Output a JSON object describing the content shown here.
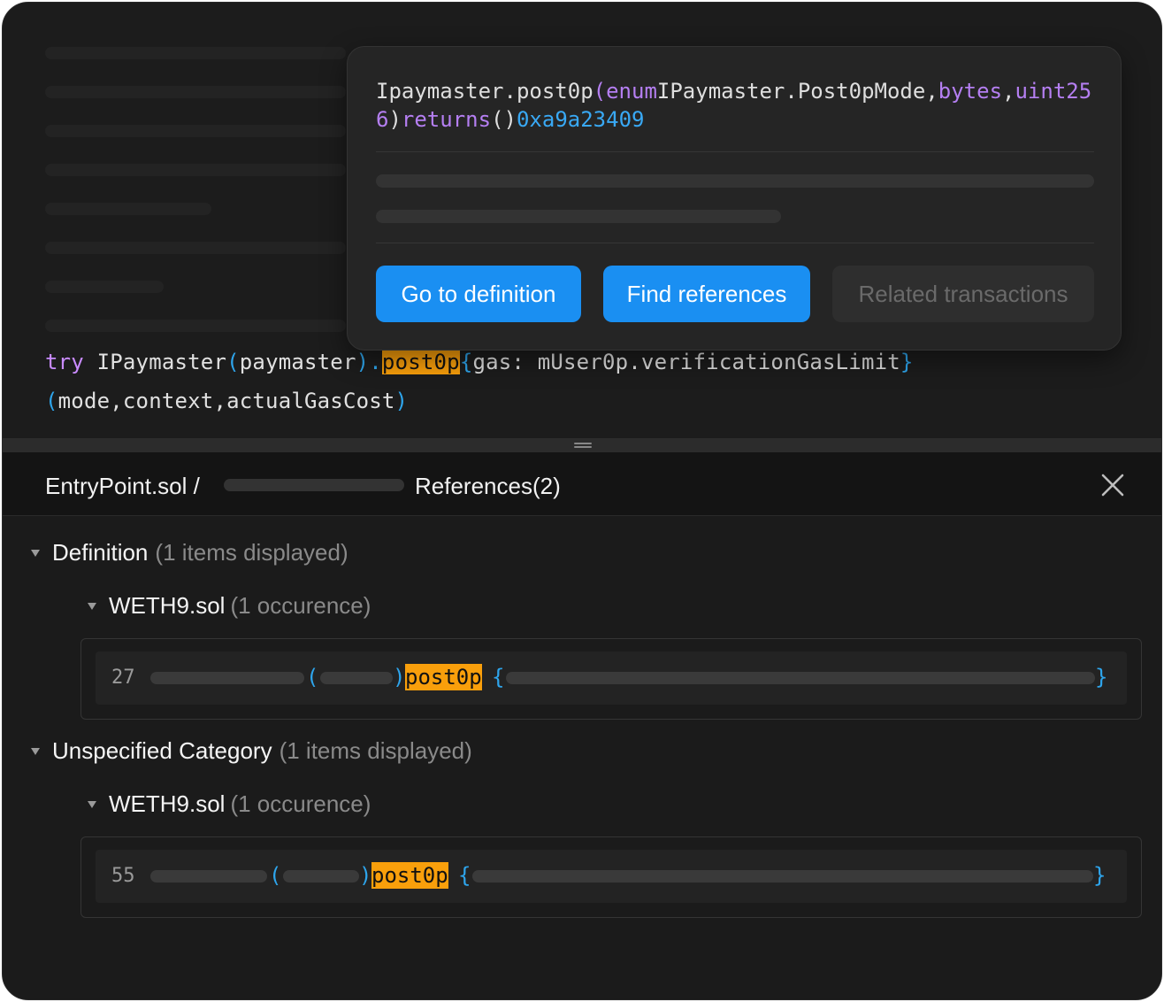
{
  "editor": {
    "code_line_1": {
      "kw_try": "try",
      "ident": " IPaymaster",
      "paren_open": "(",
      "arg": "paymaster",
      "paren_close": ")",
      "dot": ".",
      "highlight": "post0p",
      "brace_open": "{",
      "gas_text": "gas: mUser0p.verificationGasLimit",
      "brace_close": "}"
    },
    "code_line_2": {
      "paren_open": "(",
      "args": "mode,context,actualGasCost",
      "paren_close": ")"
    }
  },
  "popover": {
    "signature": {
      "name": "Ipaymaster.post0p",
      "paren_open": "(",
      "type1": "enum",
      "type1_name": "IPaymaster.Post0pMode",
      "comma1": ",",
      "type2": "bytes",
      "comma2": ",",
      "type3": "uint256",
      "paren_close": ")",
      "returns_kw": "returns",
      "returns_parens": "()",
      "selector": "0xa9a23409"
    },
    "buttons": {
      "go_to_definition": "Go to definition",
      "find_references": "Find references",
      "related_transactions": "Related transactions"
    }
  },
  "panel": {
    "breadcrumb_file": "EntryPoint.sol /",
    "breadcrumb_title": "References(2)",
    "groups": [
      {
        "title": "Definition",
        "count": "(1 items displayed)",
        "file": "WETH9.sol",
        "file_count": "(1 occurence)",
        "line_number": "27",
        "match": "post0p"
      },
      {
        "title": "Unspecified Category",
        "count": "(1 items displayed)",
        "file": "WETH9.sol",
        "file_count": "(1 occurence)",
        "line_number": "55",
        "match": "post0p"
      }
    ],
    "ref_punct": {
      "paren_open": "(",
      "paren_close": ")",
      "brace_open": "{",
      "brace_close": "}"
    }
  },
  "colors": {
    "accent": "#1a8ff2",
    "highlight": "#f99f0b",
    "keyword": "#c98bff",
    "bracket": "#2ea5ec"
  }
}
